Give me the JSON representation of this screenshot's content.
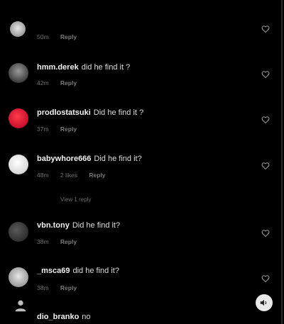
{
  "comments": [
    {
      "user": "",
      "text": "",
      "time": "50m",
      "reply": "Reply"
    },
    {
      "user": "hmm.derek",
      "text": "did he find it ?",
      "time": "42m",
      "reply": "Reply"
    },
    {
      "user": "prodlostatsuki",
      "text": "Did he find it ?",
      "time": "37m",
      "reply": "Reply"
    },
    {
      "user": "babywhore666",
      "text": "Did he find it?",
      "time": "48m",
      "likes": "2 likes",
      "reply": "Reply"
    },
    {
      "user": "vbn.tony",
      "text": "Did he find it?",
      "time": "38m",
      "reply": "Reply"
    },
    {
      "user": "_msca69",
      "text": "did he find it?",
      "time": "38m",
      "reply": "Reply"
    },
    {
      "user": "dio_branko",
      "text": "no"
    }
  ],
  "view_replies": "View 1 reply",
  "colors": {
    "background": "#000000",
    "text": "#e9e9e9",
    "meta": "#6f6f6f"
  }
}
